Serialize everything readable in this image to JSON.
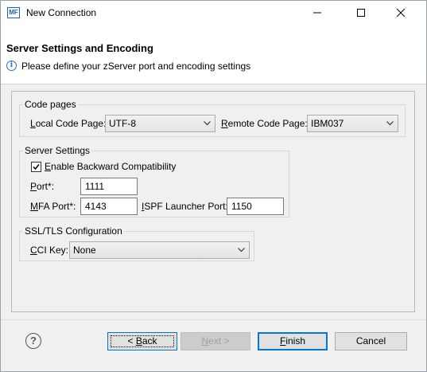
{
  "window": {
    "title": "New Connection",
    "icon_name": "mf-app-icon",
    "icon_text": "MF"
  },
  "header": {
    "title": "Server Settings and Encoding",
    "description": "Please define your zServer port and encoding settings",
    "info_icon": "info-icon"
  },
  "code_pages": {
    "group_title": "Code pages",
    "local_label": "Local Code Page:",
    "local_value": "UTF-8",
    "remote_label": "Remote Code Page:",
    "remote_value": "IBM037"
  },
  "server_settings": {
    "group_title": "Server Settings",
    "backward_compat_label": "Enable Backward Compatibility",
    "backward_compat_checked": true,
    "port_label": "Port*:",
    "port_value": "1111",
    "mfa_port_label": "MFA Port*:",
    "mfa_port_value": "4143",
    "ispf_port_label": "ISPF Launcher Port:",
    "ispf_port_value": "1150"
  },
  "ssl": {
    "group_title": "SSL/TLS Configuration",
    "cci_key_label": "CCI Key:",
    "cci_key_value": "None"
  },
  "footer": {
    "help_icon": "question-icon",
    "back_label": "< Back",
    "next_label": "Next >",
    "finish_label": "Finish",
    "cancel_label": "Cancel"
  }
}
